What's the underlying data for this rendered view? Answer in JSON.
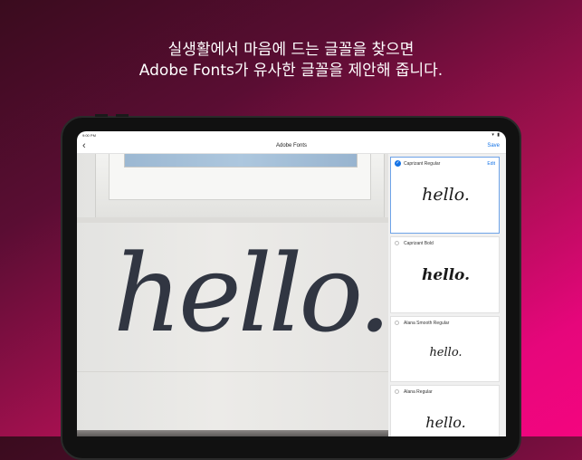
{
  "headline": {
    "line1": "실생활에서 마음에 드는 글꼴을 찾으면",
    "line2": "Adobe Fonts가 유사한 글꼴을 제안해 줍니다."
  },
  "status_bar": {
    "time": "9:00 PM",
    "icons": "▾ ▮"
  },
  "nav": {
    "back_icon": "‹",
    "title": "Adobe Fonts",
    "save": "Save"
  },
  "photo": {
    "text": "hello."
  },
  "fonts": [
    {
      "name": "Caprizant Regular",
      "selected": true,
      "action": "Edit",
      "sample": "hello."
    },
    {
      "name": "Caprizant Bold",
      "selected": false,
      "sample": "hello."
    },
    {
      "name": "Alana Smooth Regular",
      "selected": false,
      "sample": "hello."
    },
    {
      "name": "Alana Regular",
      "selected": false,
      "sample": "hello."
    }
  ],
  "colors": {
    "accent": "#1473e6",
    "background_end": "#f4057f"
  }
}
